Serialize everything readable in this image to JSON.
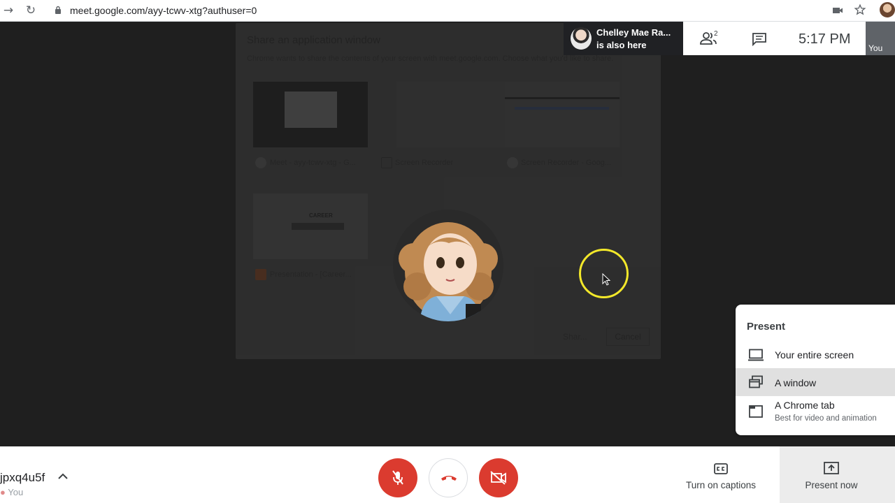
{
  "browser": {
    "url": "meet.google.com/ayy-tcwv-xtg?authuser=0",
    "icons": [
      "back-icon",
      "reload-icon",
      "lock-icon",
      "camera-icon",
      "star-icon"
    ]
  },
  "share_dialog": {
    "title": "Share an application window",
    "description": "Chrome wants to share the contents of your screen with meet.google.com. Choose what you'd like to share.",
    "windows": [
      {
        "label": "Meet - ayy-tcwv-xtg - G..."
      },
      {
        "label": "Screen Recorder"
      },
      {
        "label": "Screen Recorder - Goog..."
      },
      {
        "label": "Presentation - [Career..."
      }
    ],
    "share_label": "Shar...",
    "cancel_label": "Cancel"
  },
  "header": {
    "notification_name": "Chelley Mae Ra...",
    "notification_sub": "is also here",
    "people_count": "2",
    "time": "5:17 PM",
    "self_label": "You"
  },
  "present_menu": {
    "title": "Present",
    "items": [
      {
        "label": "Your entire screen",
        "icon": "laptop-icon"
      },
      {
        "label": "A window",
        "icon": "window-icon"
      },
      {
        "label": "A Chrome tab",
        "sub": "Best for video and animation",
        "icon": "tab-icon"
      }
    ],
    "selected_index": 1
  },
  "bottom": {
    "meeting_code": "jpxq4u5f",
    "you_label": "You",
    "captions_label": "Turn on captions",
    "present_now_label": "Present now"
  },
  "colors": {
    "accent_red": "#db3b2f",
    "highlight_yellow": "#f3e82a",
    "selected_bg": "#e0e0e0"
  }
}
